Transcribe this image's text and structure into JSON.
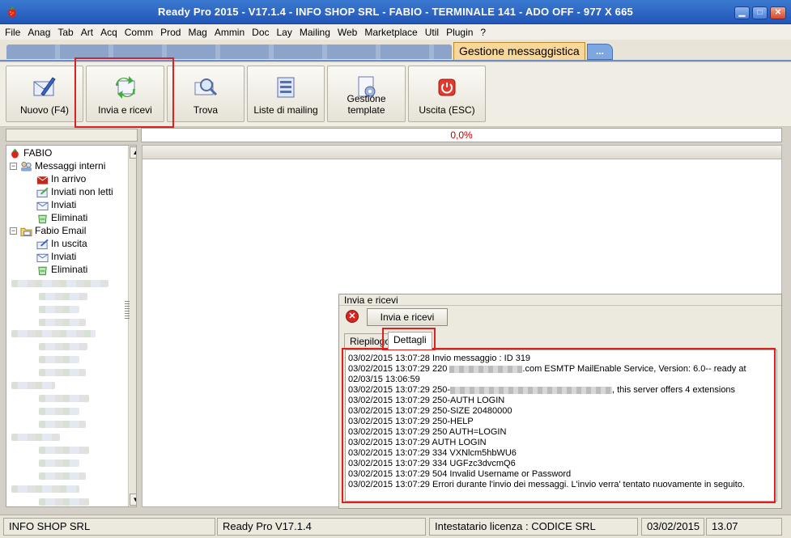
{
  "window": {
    "title": "Ready Pro 2015 - V17.1.4 - INFO SHOP SRL - FABIO - TERMINALE 141 - ADO OFF - 977 X 665",
    "minimize": "▁",
    "maximize": "□",
    "close": "✕"
  },
  "menu": [
    "File",
    "Anag",
    "Tab",
    "Art",
    "Acq",
    "Comm",
    "Prod",
    "Mag",
    "Ammin",
    "Doc",
    "Lay",
    "Mailing",
    "Web",
    "Marketplace",
    "Util",
    "Plugin",
    "?"
  ],
  "tabs": {
    "active": "Gestione messaggistica",
    "more": "..."
  },
  "toolbar": {
    "buttons": [
      {
        "label": "Nuovo (F4)",
        "icon": "new-message-icon"
      },
      {
        "label": "Invia e ricevi",
        "icon": "send-receive-icon"
      },
      {
        "label": "Trova",
        "icon": "find-icon"
      },
      {
        "label": "Liste di mailing",
        "icon": "mailing-list-icon"
      },
      {
        "label": "Gestione template",
        "icon": "template-icon"
      },
      {
        "label": "Uscita (ESC)",
        "icon": "exit-icon"
      }
    ]
  },
  "progress": {
    "text": "0,0%"
  },
  "tree": {
    "root": "FABIO",
    "internal": {
      "label": "Messaggi interni",
      "items": [
        "In arrivo",
        "Inviati non letti",
        "Inviati",
        "Eliminati"
      ]
    },
    "email": {
      "label": "Fabio Email",
      "items": [
        "In uscita",
        "Inviati",
        "Eliminati"
      ]
    }
  },
  "dialog": {
    "title": "Invia e ricevi",
    "button": "Invia e ricevi",
    "tabs": [
      "Riepilogo",
      "Dettagli"
    ],
    "log": [
      "03/02/2015 13:07:28 Invio messaggio : ID 319",
      "03/02/2015 13:07:29 220 ",
      ".com ESMTP MailEnable Service, Version: 6.0-- ready at 02/03/15 13:06:59",
      "03/02/2015 13:07:29 250-",
      ", this server offers 4 extensions",
      "03/02/2015 13:07:29 250-AUTH LOGIN",
      "03/02/2015 13:07:29 250-SIZE 20480000",
      "03/02/2015 13:07:29 250-HELP",
      "03/02/2015 13:07:29 250 AUTH=LOGIN",
      "03/02/2015 13:07:29 AUTH LOGIN",
      "03/02/2015 13:07:29 334 VXNlcm5hbWU6",
      "03/02/2015 13:07:29 334 UGFzc3dvcmQ6",
      "03/02/2015 13:07:29 504 Invalid Username or Password",
      "03/02/2015 13:07:29 Errori durante l'invio dei messaggi. L'invio verra' tentato nuovamente in seguito."
    ]
  },
  "status": {
    "company": "INFO SHOP SRL",
    "version": "Ready Pro V17.1.4",
    "license": "Intestatario licenza : CODICE SRL",
    "date": "03/02/2015",
    "time": "13.07"
  },
  "colors": {
    "highlight": "#e0201c",
    "titlebar": "#2a62c4",
    "progress_text": "#c00000"
  }
}
